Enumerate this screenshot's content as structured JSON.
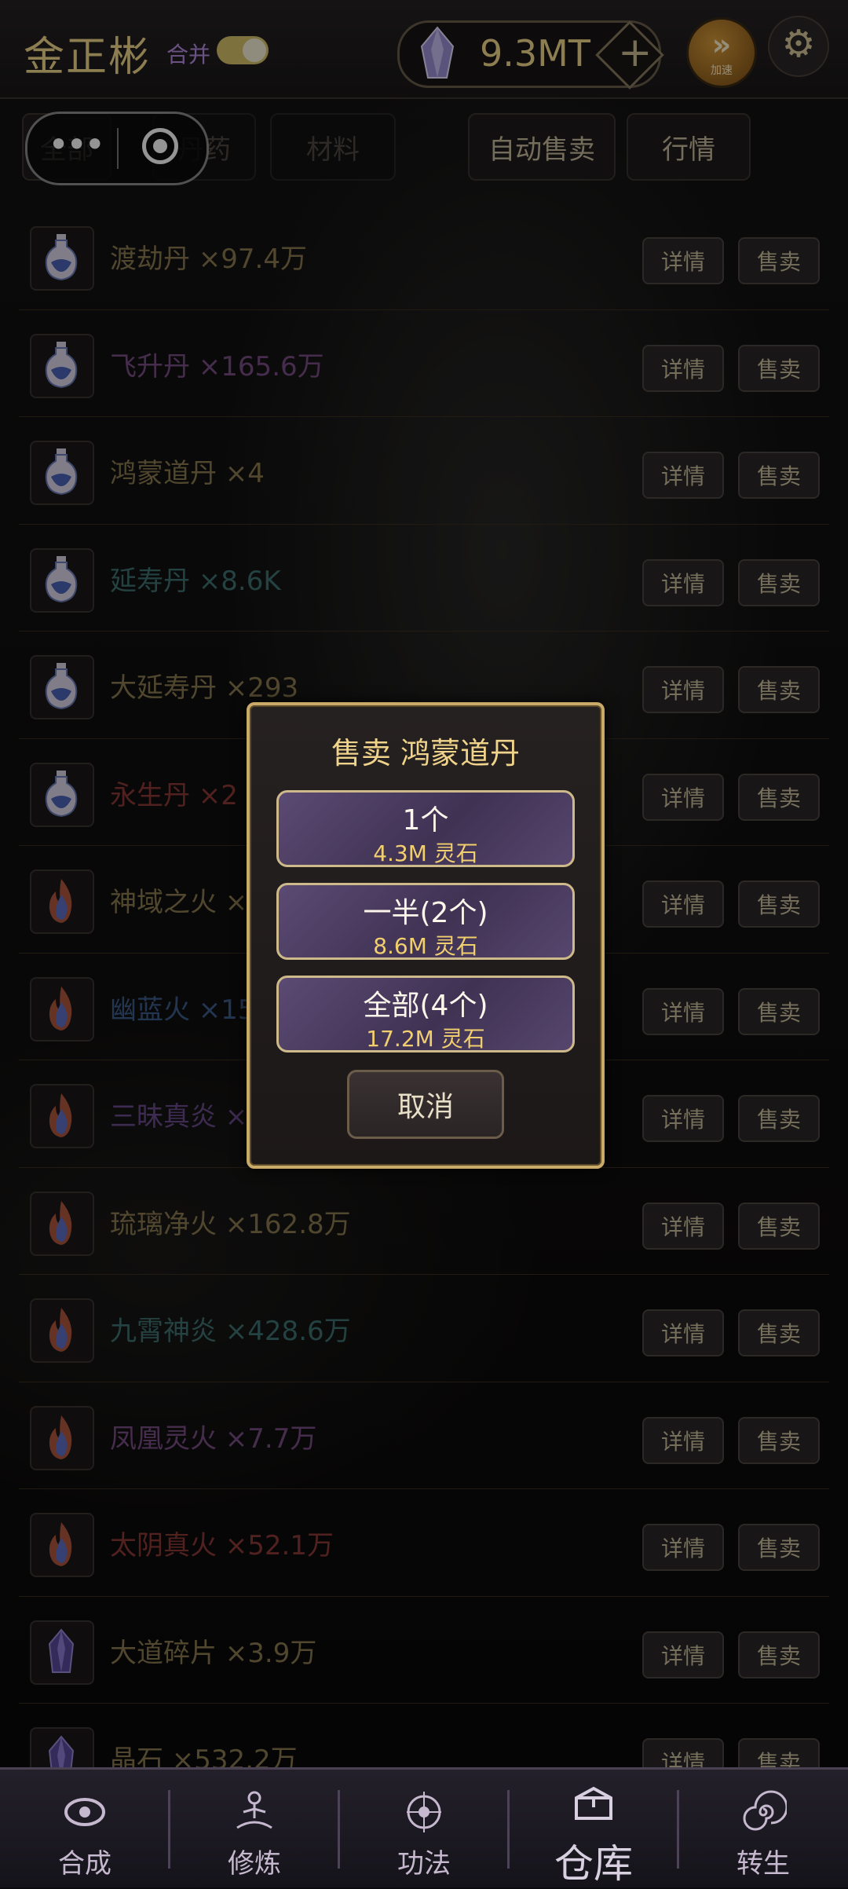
{
  "header": {
    "player_name": "金正彬",
    "merge_label": "合并",
    "merge_enabled": true,
    "currency_amount": "9.3MT",
    "speed_label": "加速"
  },
  "filters": {
    "all_label": "全部",
    "pills_label": "丹药",
    "materials_label": "材料",
    "auto_sell_label": "自动售卖",
    "market_label": "行情"
  },
  "items": [
    {
      "name": "渡劫丹 ×97.4万",
      "color": "#8a7a50",
      "icon": "vase-icon"
    },
    {
      "name": "飞升丹 ×165.6万",
      "color": "#7b4f86",
      "icon": "vase-icon"
    },
    {
      "name": "鸿蒙道丹 ×4",
      "color": "#8a7a50",
      "icon": "vase-icon"
    },
    {
      "name": "延寿丹 ×8.6K",
      "color": "#3f7270",
      "icon": "vase-icon"
    },
    {
      "name": "大延寿丹 ×293",
      "color": "#8a7a50",
      "icon": "vase-icon"
    },
    {
      "name": "永生丹 ×2",
      "color": "#8a3a36",
      "icon": "vase-icon"
    },
    {
      "name": "神域之火 ×",
      "color": "#8a7a50",
      "icon": "flame-icon"
    },
    {
      "name": "幽蓝火 ×15",
      "color": "#3d5d8c",
      "icon": "flame-icon"
    },
    {
      "name": "三昧真炎 ×",
      "color": "#6b4a8c",
      "icon": "flame-icon"
    },
    {
      "name": "琉璃净火 ×162.8万",
      "color": "#8a7a50",
      "icon": "flame-icon"
    },
    {
      "name": "九霄神炎 ×428.6万",
      "color": "#3f7270",
      "icon": "flame-icon"
    },
    {
      "name": "凤凰灵火 ×7.7万",
      "color": "#7b4f86",
      "icon": "flame-icon"
    },
    {
      "name": "太阴真火 ×52.1万",
      "color": "#8a3a36",
      "icon": "flame-icon"
    },
    {
      "name": "大道碎片 ×3.9万",
      "color": "#8a7a50",
      "icon": "crystal-icon"
    },
    {
      "name": "晶石 ×532.2万",
      "color": "#8a7a50",
      "icon": "crystal-icon"
    }
  ],
  "row_buttons": {
    "detail": "详情",
    "sell": "售卖"
  },
  "dialog": {
    "title": "售卖 鸿蒙道丹",
    "options": [
      {
        "label": "1个",
        "price": "4.3M 灵石"
      },
      {
        "label": "一半(2个)",
        "price": "8.6M 灵石"
      },
      {
        "label": "全部(4个)",
        "price": "17.2M 灵石"
      }
    ],
    "cancel": "取消"
  },
  "nav": [
    {
      "label": "合成",
      "icon": "swirl-icon",
      "active": false
    },
    {
      "label": "修炼",
      "icon": "meditation-icon",
      "active": false
    },
    {
      "label": "功法",
      "icon": "emblem-icon",
      "active": false
    },
    {
      "label": "仓库",
      "icon": "chest-icon",
      "active": true
    },
    {
      "label": "转生",
      "icon": "spiral-icon",
      "active": false
    }
  ]
}
